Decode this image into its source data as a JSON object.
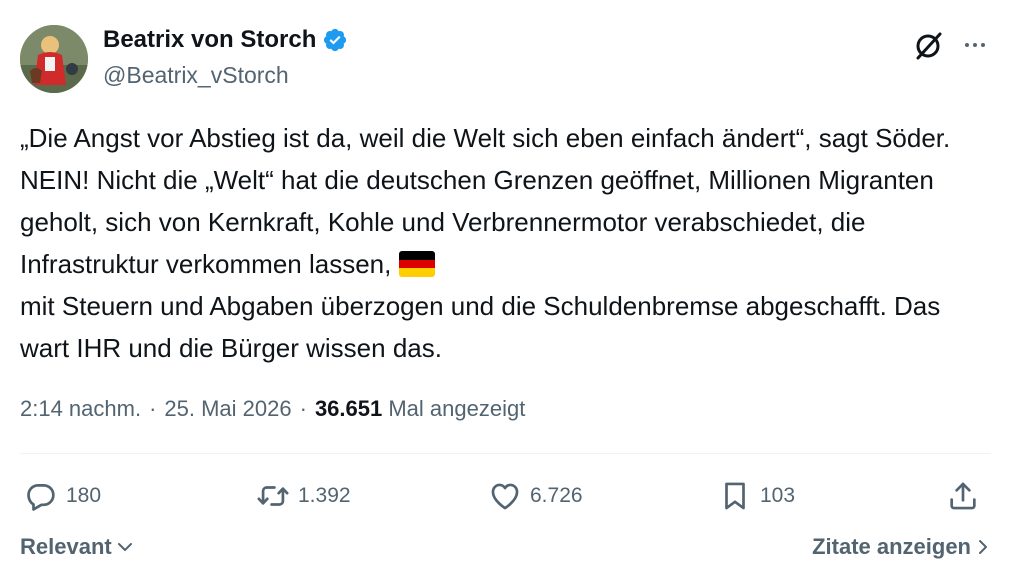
{
  "author": {
    "display_name": "Beatrix von Storch",
    "handle": "@Beatrix_vStorch",
    "verified_icon": "verified-badge-icon"
  },
  "tweet": {
    "text": "„Die Angst vor Abstieg ist da, weil die Welt sich eben einfach ändert“, sagt Söder. NEIN! Nicht die „Welt“ hat die deutschen Grenzen geöffnet, Millionen Migranten geholt, sich von Kernkraft, Kohle und Verbrennermotor verabschiedet, die Infrastruktur verkommen lassen,",
    "text_after_flag": "mit Steuern und Abgaben überzogen und die Schuldenbremse abgeschafft. Das wart IHR und die Bürger wissen das.",
    "flag": "germany-flag",
    "time": "2:14 nachm.",
    "separator": "·",
    "date": "25. Mai 2026",
    "views_count": "36.651",
    "views_label": "Mal angezeigt"
  },
  "actions": {
    "replies": "180",
    "reposts": "1.392",
    "likes": "6.726",
    "bookmarks": "103"
  },
  "footer": {
    "sort_label": "Relevant",
    "quotes_label": "Zitate anzeigen"
  },
  "colors": {
    "text": "#0f1419",
    "secondary": "#536471",
    "verified": "#1d9bf0",
    "divider": "#eff3f4"
  }
}
